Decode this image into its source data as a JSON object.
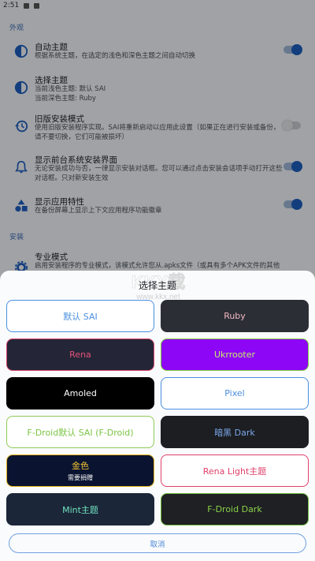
{
  "status": {
    "time": "2:51"
  },
  "sections": {
    "appearance": "外观",
    "install": "安装"
  },
  "prefs": [
    {
      "title": "自动主题",
      "summary": "根据系统主题，在选定的浅色和深色主题之间自动切换",
      "icon": "theme-contrast-icon",
      "toggle": true
    },
    {
      "title": "选择主题",
      "summary_l1": "当前浅色主题: 默认 SAI",
      "summary_l2": "当前深色主题: Ruby",
      "icon": "theme-contrast-icon"
    },
    {
      "title": "旧版安装模式",
      "summary": "使用旧版安装程序实现。SAI将重新启动以应用此设置（如果正在进行安装或备份，请不要切换，它们可能被损坏）",
      "icon": "history-icon",
      "toggle": false
    },
    {
      "title": "显示前台系统安装界面",
      "summary": "无论安装成功与否，一律显示安装对话框。您可以通过点击安装会话项手动打开这些对话框。只对新安装生效",
      "icon": "bell-icon",
      "toggle": true
    },
    {
      "title": "显示应用特性",
      "summary": "在备份屏幕上显示上下文应用程序功能徽章",
      "icon": "shapes-icon",
      "toggle": true
    },
    {
      "title": "专业模式",
      "summary": "启用安装程序的专业模式，该模式允许您从.apks文件（或具有多个APK文件的其他压缩文件）中选择要安装的拆分APK，可获取更多选项。",
      "icon": "gear-icon"
    }
  ],
  "dialog": {
    "title": "选择主题",
    "cancel": "取消",
    "themes": [
      {
        "name": "默认 SAI",
        "bg": "#ffffff",
        "fg": "#4a8fe0",
        "border": "#4a8fe0"
      },
      {
        "name": "Ruby",
        "bg": "#2c2e36",
        "fg": "#f0b8c0",
        "border": "#2c2e36"
      },
      {
        "name": "Rena",
        "bg": "#242637",
        "fg": "#e8507a",
        "border": "#d8446c"
      },
      {
        "name": "Ukrrooter",
        "bg": "#8d06f5",
        "fg": "#c7f06a",
        "border": "#7ed03f"
      },
      {
        "name": "Amoled",
        "bg": "#000000",
        "fg": "#ffffff",
        "border": "#000000"
      },
      {
        "name": "Pixel",
        "bg": "#ffffff",
        "fg": "#4a8fe0",
        "border": "#4a8fe0"
      },
      {
        "name": "F-Droid默认 SAI (F-Droid)",
        "bg": "#ffffff",
        "fg": "#7bc444",
        "border": "#8ccc55"
      },
      {
        "name": "暗黑 Dark",
        "bg": "#1c1e22",
        "fg": "#7aa8ea",
        "border": "#1c1e22"
      },
      {
        "name": "金色",
        "sub": "需要捐赠",
        "bg": "#0a1430",
        "fg": "#f1c232",
        "border": "#e3b21e"
      },
      {
        "name": "Rena Light主题",
        "bg": "#ffffff",
        "fg": "#e0406a",
        "border": "#e0406a"
      },
      {
        "name": "Mint主题",
        "bg": "#1b2638",
        "fg": "#6fe2c0",
        "border": "#1b2638"
      },
      {
        "name": "F-Droid Dark",
        "bg": "#1e2023",
        "fg": "#8cd14a",
        "border": "#6fb93a"
      }
    ]
  }
}
